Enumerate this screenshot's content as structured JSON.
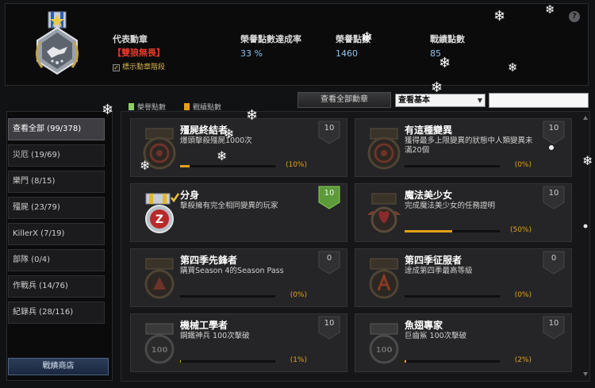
{
  "header": {
    "medal_title_label": "代表勳章",
    "medal_name": "【雙狼無畏】",
    "show_stage_label": "標示勳章階段",
    "show_stage_checked": true,
    "stats": [
      {
        "label": "榮譽點數達成率",
        "value": "33 %"
      },
      {
        "label": "榮譽點數",
        "value": "1460"
      },
      {
        "label": "戰績點數",
        "value": "85"
      }
    ],
    "help_label": "?"
  },
  "filters": {
    "legend": [
      {
        "label": "榮譽點數",
        "color": "#8ecf58"
      },
      {
        "label": "戰績點數",
        "color": "#e6a01c"
      }
    ],
    "view_all_button": "查看全部勳章",
    "select_value": "查看基本",
    "search_value": ""
  },
  "sidebar": {
    "categories": [
      {
        "label": "查看全部 (99/378)",
        "active": true
      },
      {
        "label": "災厄 (19/69)",
        "active": false
      },
      {
        "label": "樂門 (8/15)",
        "active": false
      },
      {
        "label": "殭屍 (23/79)",
        "active": false
      },
      {
        "label": "KillerX (7/19)",
        "active": false
      },
      {
        "label": "部隊 (0/4)",
        "active": false
      },
      {
        "label": "作戰兵 (14/76)",
        "active": false
      },
      {
        "label": "紀錄兵 (28/116)",
        "active": false
      }
    ],
    "shop_button": "戰績商店"
  },
  "achievements": [
    {
      "title": "殭屍終結者",
      "desc": "爆頭擊殺殭屍1000次",
      "points": "10",
      "progress_pct": 10,
      "progress_label": "(10%)",
      "earned": false,
      "icon": "zombie-target-icon"
    },
    {
      "title": "有這種變異",
      "desc": "獲得最多上限變異的狀態中人類變異未滿20個",
      "points": "10",
      "progress_pct": 0,
      "progress_label": "(0%)",
      "earned": false,
      "icon": "zombie-target-icon"
    },
    {
      "title": "分身",
      "desc": "擊殺擁有完全相同變異的玩家",
      "points": "10",
      "progress_pct": 100,
      "progress_label": "",
      "earned": true,
      "icon": "clone-z-icon"
    },
    {
      "title": "魔法美少女",
      "desc": "完成魔法美少女的任務證明",
      "points": "10",
      "progress_pct": 50,
      "progress_label": "(50%)",
      "earned": false,
      "icon": "magic-girl-icon"
    },
    {
      "title": "第四季先鋒者",
      "desc": "購買Season 4的Season Pass",
      "points": "0",
      "progress_pct": 0,
      "progress_label": "(0%)",
      "earned": false,
      "icon": "season-pioneer-icon"
    },
    {
      "title": "第四季征服者",
      "desc": "達成第四季最高等級",
      "points": "0",
      "progress_pct": 0,
      "progress_label": "(0%)",
      "earned": false,
      "icon": "season-conqueror-icon"
    },
    {
      "title": "機械工學者",
      "desc": "鋼鐵神兵 100次擊破",
      "points": "10",
      "progress_pct": 1,
      "progress_label": "(1%)",
      "earned": false,
      "icon": "mech-100-icon"
    },
    {
      "title": "魚翅專家",
      "desc": "巨齒鯊 100次擊破",
      "points": "10",
      "progress_pct": 2,
      "progress_label": "(2%)",
      "earned": false,
      "icon": "shark-100-icon"
    }
  ]
}
